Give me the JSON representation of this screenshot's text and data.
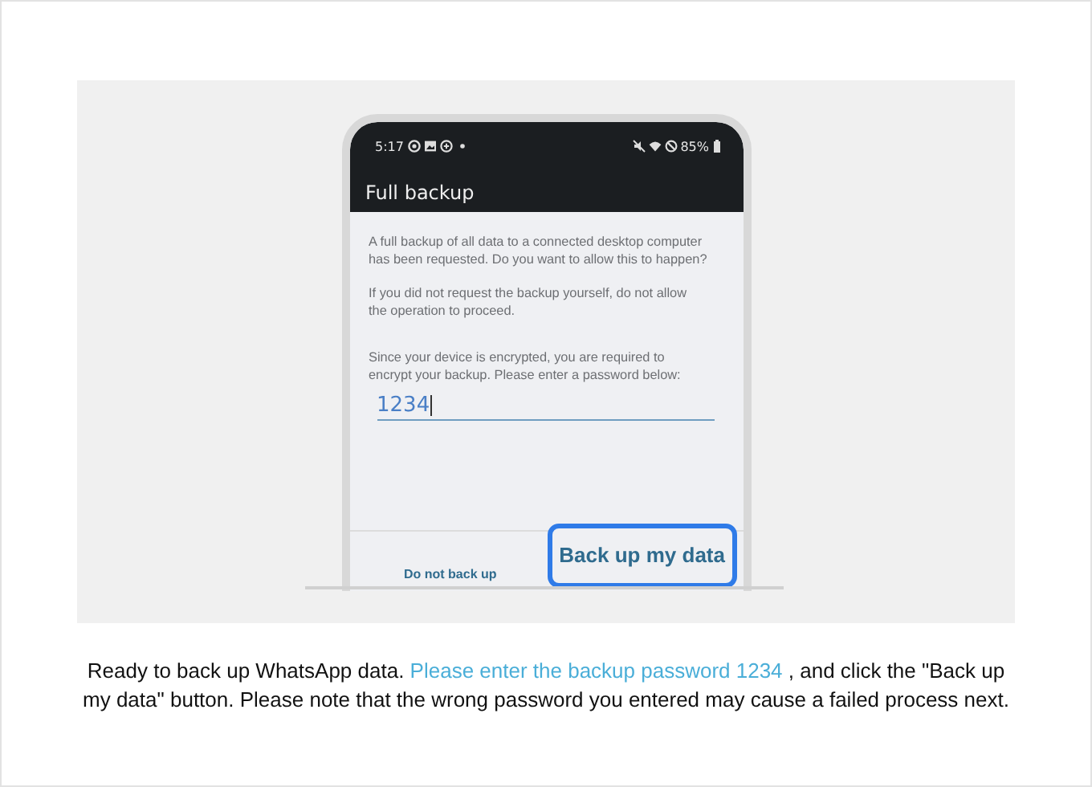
{
  "status_bar": {
    "time": "5:17",
    "battery": "85%"
  },
  "dialog": {
    "title": "Full backup",
    "paragraphs": [
      "A full backup of all data to a connected desktop computer has been requested. Do you want to allow this to happen?",
      "If you did not request the backup yourself, do not allow the operation to proceed.",
      "Since your device is encrypted, you are required to encrypt your backup. Please enter a password below:"
    ],
    "password": {
      "value": "1234"
    },
    "buttons": [
      {
        "label": "Do not back up",
        "highlighted": false
      },
      {
        "label": "Back up my data",
        "highlighted": true
      }
    ]
  },
  "caption": {
    "before": "Ready to back up WhatsApp data. ",
    "highlight": "Please enter the backup password 1234",
    "after": " , and click the \"Back up my data\" button. Please note that the wrong password you entered may cause a failed process next."
  }
}
